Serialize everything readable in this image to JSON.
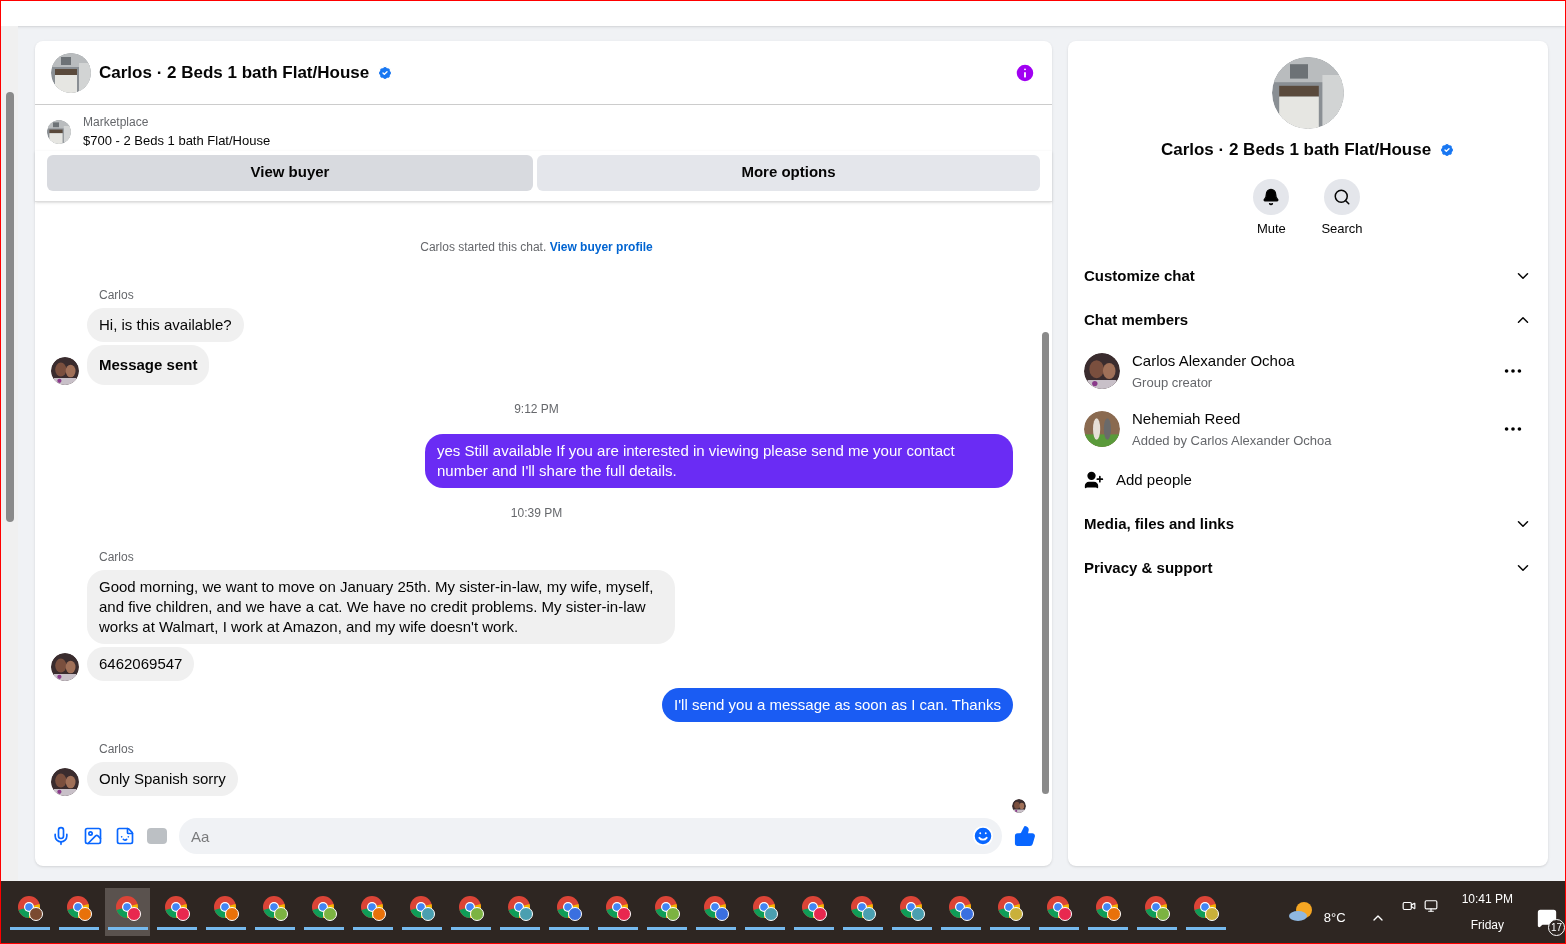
{
  "chat": {
    "title": "Carlos · 2 Beds 1 bath Flat/House",
    "verified": true,
    "listing": {
      "source": "Marketplace",
      "name": "$700 - 2 Beds 1 bath Flat/House"
    },
    "buttons": [
      {
        "label": "View buyer",
        "selected": true
      },
      {
        "label": "More options",
        "selected": false
      }
    ],
    "messages": [
      {
        "kind": "system",
        "text": "Carlos started this chat.",
        "link": "View buyer profile"
      },
      {
        "kind": "sender",
        "text": "Carlos"
      },
      {
        "kind": "incoming",
        "text": "Hi, is this available?",
        "avatar": false
      },
      {
        "kind": "incoming",
        "text": "Message sent",
        "avatar": true,
        "bold": true
      },
      {
        "kind": "time",
        "text": "9:12 PM"
      },
      {
        "kind": "outgoing",
        "text": "yes Still available If you are interested in viewing please send me your contact number and I'll share the full details.",
        "color": "#6a2cf4"
      },
      {
        "kind": "time",
        "text": "10:39 PM"
      },
      {
        "kind": "sender",
        "text": "Carlos"
      },
      {
        "kind": "incoming",
        "text": "Good morning, we want to move on January 25th. My sister-in-law, my wife, myself, and five children, and we have a cat. We have no credit problems. My sister-in-law works at Walmart, I work at Amazon, and my wife doesn't work.",
        "avatar": false
      },
      {
        "kind": "incoming",
        "text": "6462069547",
        "avatar": true
      },
      {
        "kind": "outgoing",
        "text": "I'll send you a message as soon as I can. Thanks",
        "color": "#1a5cf3"
      },
      {
        "kind": "sender",
        "text": "Carlos"
      },
      {
        "kind": "incoming",
        "text": "Only Spanish sorry",
        "avatar": true
      }
    ],
    "composer": {
      "placeholder": "Aa"
    }
  },
  "details": {
    "title": "Carlos · 2 Beds 1 bath Flat/House",
    "verified": true,
    "actions": [
      {
        "kind": "bell",
        "label": "Mute"
      },
      {
        "kind": "search",
        "label": "Search"
      }
    ],
    "sections": [
      {
        "label": "Customize chat",
        "expanded": false
      },
      {
        "label": "Chat members",
        "expanded": true,
        "members": [
          {
            "name": "Carlos Alexander Ochoa",
            "role": "Group creator"
          },
          {
            "name": "Nehemiah Reed",
            "role": "Added by Carlos Alexander Ochoa"
          }
        ],
        "add": "Add people"
      },
      {
        "label": "Media, files and links",
        "expanded": false
      },
      {
        "label": "Privacy & support",
        "expanded": false
      }
    ]
  },
  "taskbar": {
    "apps": [
      {
        "color": "#7a4a30",
        "selected": false
      },
      {
        "color": "#e8710a",
        "selected": false
      },
      {
        "color": "#e8284f",
        "selected": true
      },
      {
        "color": "#e8284f",
        "selected": false
      },
      {
        "color": "#e8710a",
        "selected": false
      },
      {
        "color": "#7cb342",
        "selected": false
      },
      {
        "color": "#7cb342",
        "selected": false
      },
      {
        "color": "#e8710a",
        "selected": false
      },
      {
        "color": "#4a9fb0",
        "selected": false
      },
      {
        "color": "#7cb342",
        "selected": false
      },
      {
        "color": "#4a9fb0",
        "selected": false
      },
      {
        "color": "#3a6fe0",
        "selected": false
      },
      {
        "color": "#e8284f",
        "selected": false
      },
      {
        "color": "#7cb342",
        "selected": false
      },
      {
        "color": "#3a6fe0",
        "selected": false
      },
      {
        "color": "#4a9fb0",
        "selected": false
      },
      {
        "color": "#e8284f",
        "selected": false
      },
      {
        "color": "#4a9fb0",
        "selected": false
      },
      {
        "color": "#4a9fb0",
        "selected": false
      },
      {
        "color": "#3a6fe0",
        "selected": false
      },
      {
        "color": "#c9b03a",
        "selected": false
      },
      {
        "color": "#e8284f",
        "selected": false
      },
      {
        "color": "#e8710a",
        "selected": false
      },
      {
        "color": "#7cb342",
        "selected": false
      },
      {
        "color": "#c9b03a",
        "selected": false
      }
    ],
    "temperature": "8°C",
    "time": "10:41 PM",
    "day": "Friday",
    "notifications": "17"
  }
}
